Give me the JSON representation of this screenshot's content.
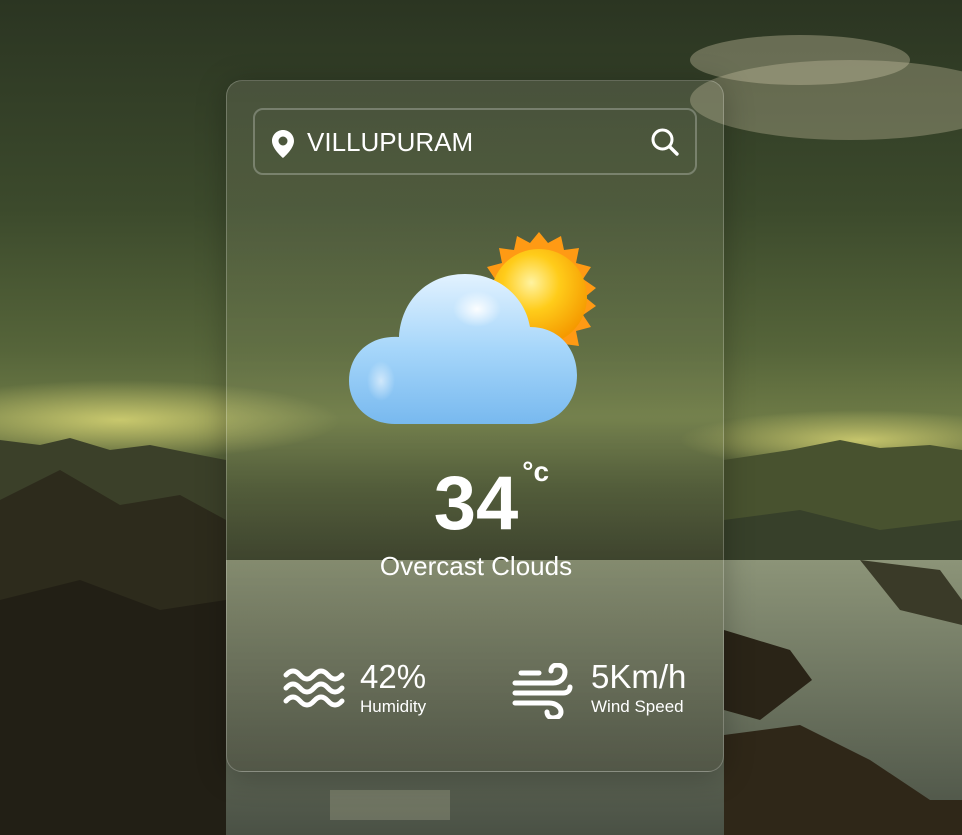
{
  "search": {
    "value": "VILLUPURAM",
    "location_icon": "map-pin-icon",
    "search_icon": "search-icon"
  },
  "weather": {
    "icon": "partly-cloudy-sun-icon",
    "temperature": "34",
    "unit": "°c",
    "condition": "Overcast Clouds"
  },
  "details": {
    "humidity": {
      "icon": "waves-icon",
      "value": "42%",
      "label": "Humidity"
    },
    "wind": {
      "icon": "wind-icon",
      "value": "5Km/h",
      "label": "Wind Speed"
    }
  },
  "colors": {
    "text": "#ffffff",
    "sun": "#ffb400",
    "cloud": "#8ec8f5"
  }
}
